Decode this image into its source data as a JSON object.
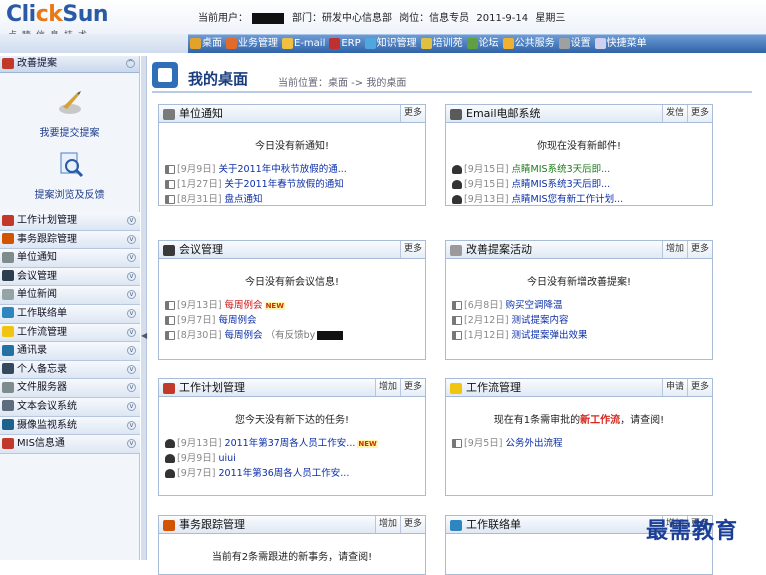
{
  "app": {
    "logo_main_1": "Cli",
    "logo_main_2": "ck",
    "logo_main_3": "Sun",
    "logo_sub": "点睛信息技术"
  },
  "header": {
    "user_label": "当前用户：",
    "dept_label": "部门：研发中心信息部",
    "post_label": "岗位：信息专员",
    "date": "2011-9-14",
    "weekday": "星期三"
  },
  "menu": [
    {
      "label": "桌面",
      "icon": "desktop-icon",
      "color": "#e3a32a"
    },
    {
      "label": "业务管理",
      "icon": "user-icon",
      "color": "#e36b2a"
    },
    {
      "label": "E-mail",
      "icon": "mail-icon",
      "color": "#f0c040"
    },
    {
      "label": "ERP",
      "icon": "globe-icon",
      "color": "#c03030"
    },
    {
      "label": "知识管理",
      "icon": "knowledge-icon",
      "color": "#4fa7e0"
    },
    {
      "label": "培训苑",
      "icon": "training-icon",
      "color": "#e0c040"
    },
    {
      "label": "论坛",
      "icon": "forum-icon",
      "color": "#60a040"
    },
    {
      "label": "公共服务",
      "icon": "service-icon",
      "color": "#f0b030"
    },
    {
      "label": "设置",
      "icon": "tools-icon",
      "color": "#a0a0a0"
    },
    {
      "label": "快捷菜单",
      "icon": "shortcut-icon",
      "color": "#d0d0f0"
    }
  ],
  "sidebar": {
    "header": "改善提案",
    "tools": [
      {
        "label": "我要提交提案"
      },
      {
        "label": "提案浏览及反馈"
      }
    ],
    "items": [
      {
        "label": "工作计划管理",
        "color": "#c0392b"
      },
      {
        "label": "事务跟踪管理",
        "color": "#d35400"
      },
      {
        "label": "单位通知",
        "color": "#7f8c8d"
      },
      {
        "label": "会议管理",
        "color": "#2c3e50"
      },
      {
        "label": "单位新闻",
        "color": "#95a5a6"
      },
      {
        "label": "工作联络单",
        "color": "#2e86c1"
      },
      {
        "label": "工作流管理",
        "color": "#f1c40f"
      },
      {
        "label": "通讯录",
        "color": "#2471a3"
      },
      {
        "label": "个人备忘录",
        "color": "#34495e"
      },
      {
        "label": "文件服务器",
        "color": "#7f8c8d"
      },
      {
        "label": "文本会议系统",
        "color": "#5d6d7e"
      },
      {
        "label": "摄像监视系统",
        "color": "#1f618d"
      },
      {
        "label": "MIS信息通",
        "color": "#c0392b"
      }
    ]
  },
  "page": {
    "title": "我的桌面",
    "breadcrumb": "当前位置：桌面 -> 我的桌面"
  },
  "panels": [
    {
      "title": "单位通知",
      "buttons": [
        "更多"
      ],
      "message": "今日没有新通知!",
      "rows": [
        {
          "date": "[9月9日]",
          "text": "关于2011年中秋节放假的通...",
          "cls": ""
        },
        {
          "date": "[1月27日]",
          "text": "关于2011年春节放假的通知",
          "cls": ""
        },
        {
          "date": "[8月31日]",
          "text": "盘点通知",
          "cls": ""
        }
      ]
    },
    {
      "title": "Email电邮系统",
      "buttons": [
        "发信",
        "更多"
      ],
      "message": "你现在没有新邮件!",
      "rows": [
        {
          "date": "[9月15日]",
          "text": "点睛MIS系统3天后即...",
          "cls": "green"
        },
        {
          "date": "[9月15日]",
          "text": "点睛MIS系统3天后即...",
          "cls": ""
        },
        {
          "date": "[9月13日]",
          "text": "点睛MIS您有新工作计划...",
          "cls": ""
        }
      ]
    },
    {
      "title": "会议管理",
      "buttons": [
        "更多"
      ],
      "message": "今日没有新会议信息!",
      "rows": [
        {
          "date": "[9月13日]",
          "text": "每周例会",
          "cls": "red",
          "new": "NEW"
        },
        {
          "date": "[9月7日]",
          "text": "每周例会",
          "cls": ""
        },
        {
          "date": "[8月30日]",
          "text": "每周例会",
          "cls": "",
          "note": "（有反馈by"
        }
      ]
    },
    {
      "title": "改善提案活动",
      "buttons": [
        "增加",
        "更多"
      ],
      "message": "今日没有新增改善提案!",
      "rows": [
        {
          "date": "[6月8日]",
          "text": "购买空调降温",
          "cls": ""
        },
        {
          "date": "[2月12日]",
          "text": "测试提案内容",
          "cls": ""
        },
        {
          "date": "[1月12日]",
          "text": "测试提案弹出效果",
          "cls": ""
        }
      ]
    },
    {
      "title": "工作计划管理",
      "buttons": [
        "增加",
        "更多"
      ],
      "message": "您今天没有新下达的任务!",
      "rows": [
        {
          "date": "[9月13日]",
          "text": "2011年第37周各人员工作安...",
          "cls": "",
          "new": "NEW"
        },
        {
          "date": "[9月9日]",
          "text": "uiui",
          "cls": ""
        },
        {
          "date": "[9月7日]",
          "text": "2011年第36周各人员工作安...",
          "cls": ""
        }
      ]
    },
    {
      "title": "工作流管理",
      "buttons": [
        "申请",
        "更多"
      ],
      "message_pre": "现在有1条需审批的",
      "message_em": "新工作流",
      "message_post": "，请查阅!",
      "rows": [
        {
          "date": "[9月5日]",
          "text": "公务外出流程",
          "cls": ""
        }
      ]
    },
    {
      "title": "事务跟踪管理",
      "buttons": [
        "增加",
        "更多"
      ],
      "message": "当前有2条需跟进的新事务，请查阅!",
      "rows": []
    },
    {
      "title": "工作联络单",
      "buttons": [
        "增加",
        "更多"
      ],
      "message": "",
      "rows": []
    }
  ],
  "watermark": "最需教育"
}
